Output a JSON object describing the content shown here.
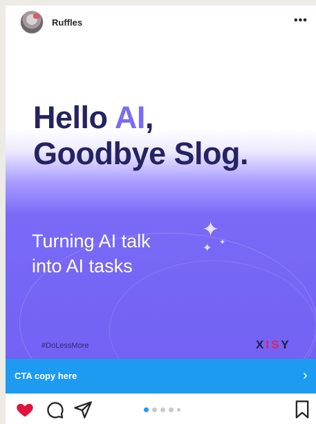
{
  "post": {
    "username": "Ruffles",
    "more_label": "•••"
  },
  "creative": {
    "headline_line1_a": "Hello ",
    "headline_line1_accent": "AI",
    "headline_line1_b": ",",
    "headline_line2": "Goodbye Slog.",
    "tagline_line1": "Turning AI talk",
    "tagline_line2": "into AI tasks",
    "hashtag": "#DoLessMore",
    "brand_part1": "X",
    "brand_part2": "IS",
    "brand_part3": "Y"
  },
  "cta": {
    "label": "CTA copy here",
    "chevron": "›"
  },
  "carousel": {
    "total": 5,
    "active_index": 0
  },
  "icons": {
    "avatar": "avatar",
    "more": "ellipsis-icon",
    "like": "heart-icon",
    "comment": "comment-icon",
    "share": "paper-plane-icon",
    "save": "bookmark-icon"
  },
  "colors": {
    "accent_purple": "#7b6cf4",
    "headline_navy": "#262362",
    "cta_blue": "#1d9bf0",
    "like_red": "#e0143c",
    "brand_pink": "#e3225c",
    "dot_active": "#1d9bf0"
  }
}
